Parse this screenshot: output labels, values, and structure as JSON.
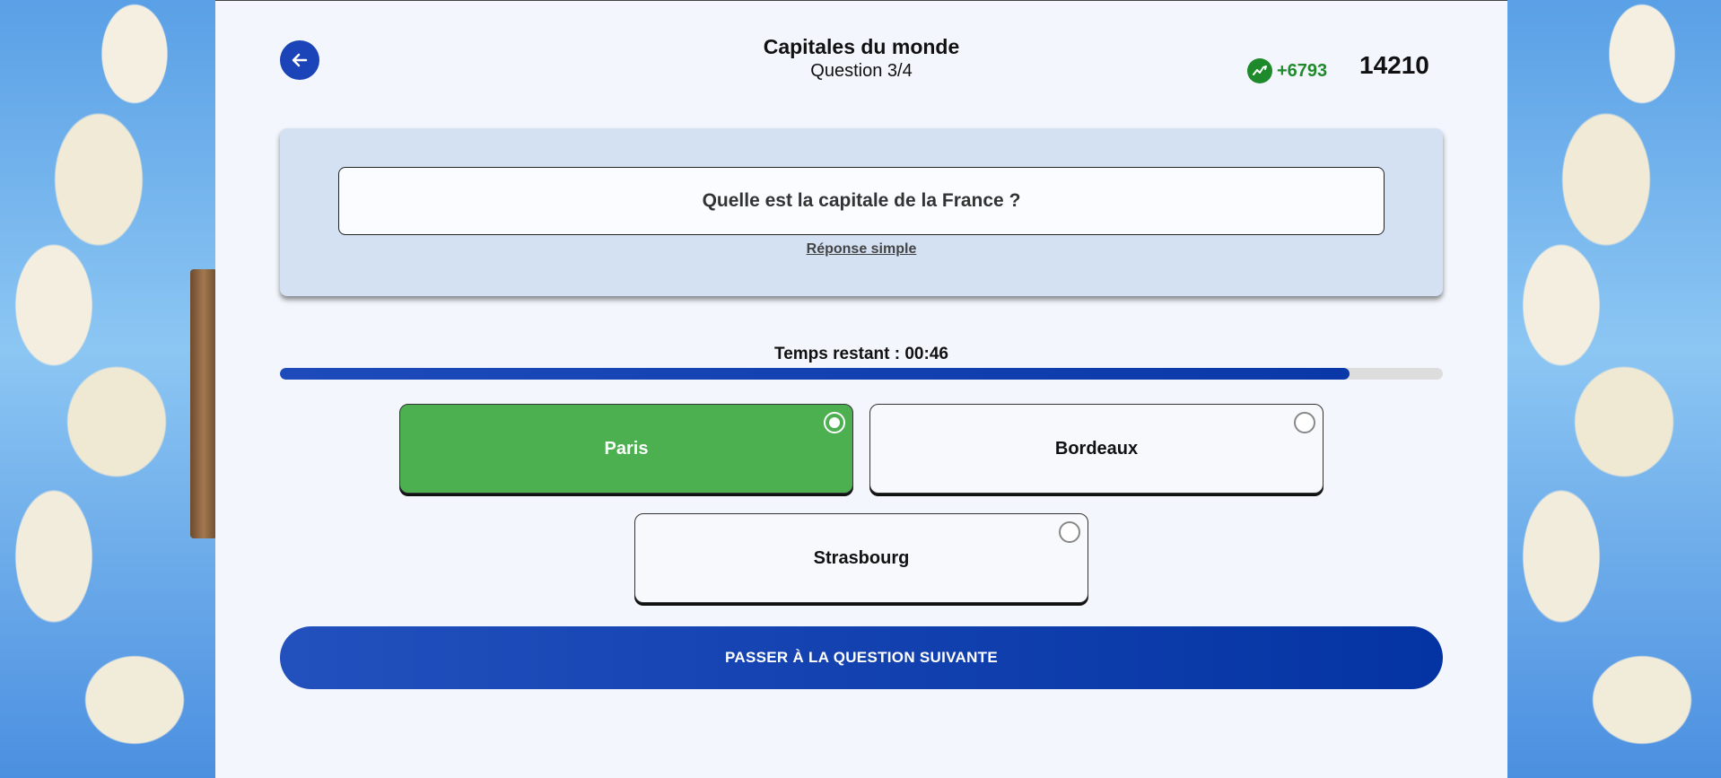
{
  "header": {
    "back_icon": "arrow-left-icon",
    "quiz_title": "Capitales du monde",
    "question_count": "Question 3/4",
    "score_gain_icon": "trending-up-icon",
    "score_gain": "+6793",
    "score_total": "14210"
  },
  "question": {
    "text": "Quelle est la capitale de la France ?",
    "answer_type": "Réponse simple"
  },
  "timer": {
    "label": "Temps restant : 00:46",
    "remaining_fraction": 0.92
  },
  "options": [
    {
      "label": "Paris",
      "selected": true
    },
    {
      "label": "Bordeaux",
      "selected": false
    },
    {
      "label": "Strasbourg",
      "selected": false
    }
  ],
  "next_button": {
    "label": "PASSER À LA QUESTION SUIVANTE"
  },
  "colors": {
    "accent": "#1a44b8",
    "selected_option": "#4caf50",
    "gain": "#1f8a2c",
    "card": "#d4e1f3"
  }
}
